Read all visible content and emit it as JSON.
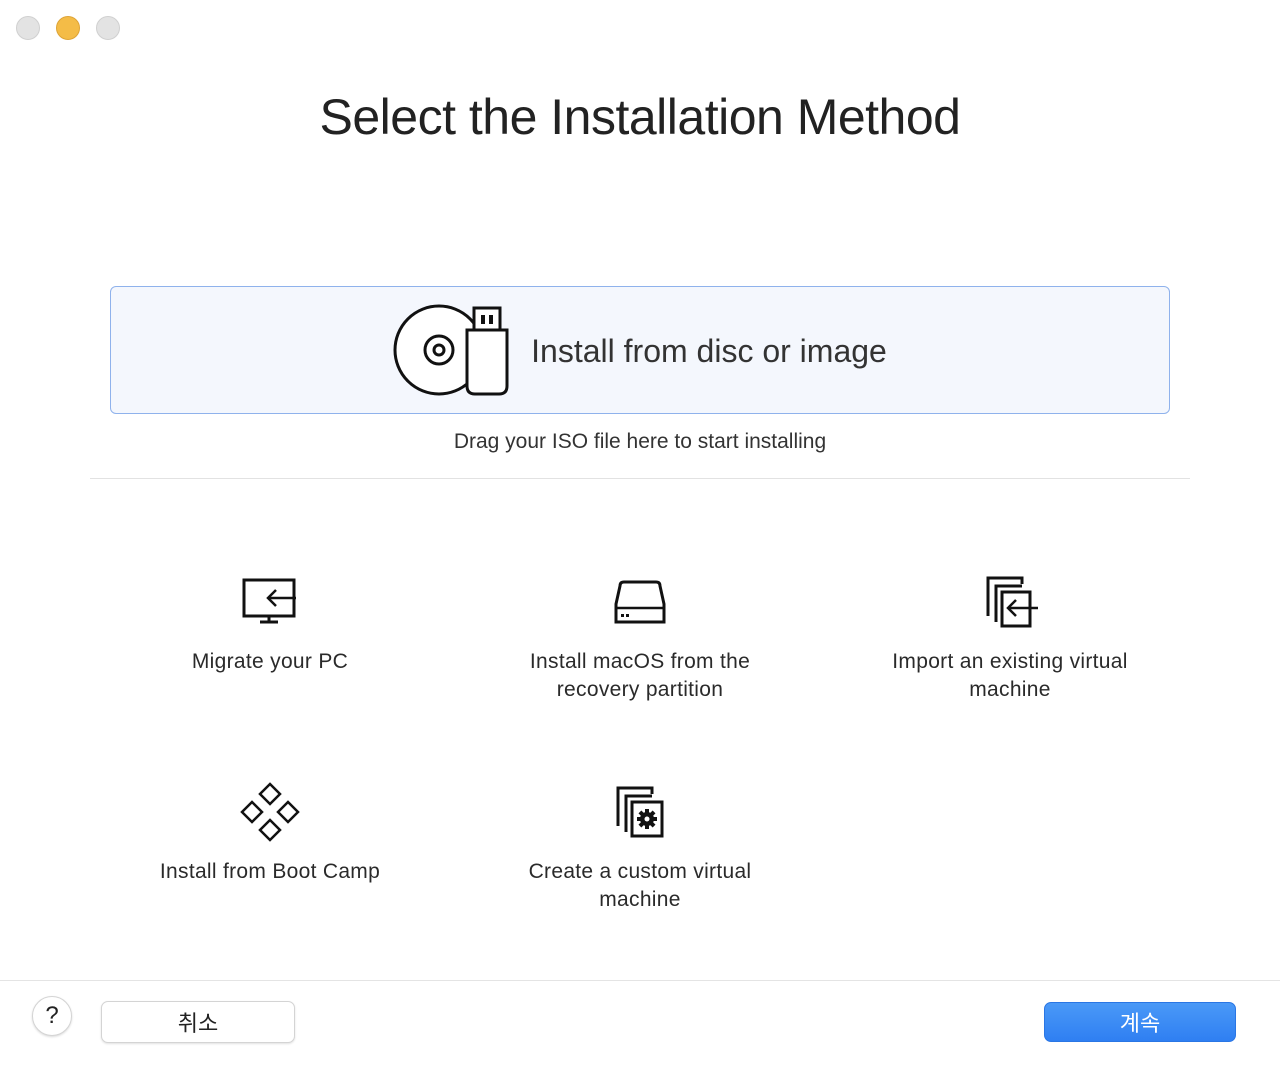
{
  "window": {
    "controls": [
      "close",
      "minimize",
      "zoom"
    ]
  },
  "page": {
    "title": "Select the Installation Method"
  },
  "dropzone": {
    "label": "Install from disc or image",
    "icon": "disc-usb-icon",
    "hint": "Drag your ISO file here to start installing"
  },
  "options": {
    "migrate": {
      "label": "Migrate your PC",
      "icon": "monitor-import-icon"
    },
    "recovery": {
      "label": "Install macOS from the recovery partition",
      "icon": "hard-drive-icon"
    },
    "import": {
      "label": "Import an existing virtual machine",
      "icon": "import-vm-icon"
    },
    "bootcamp": {
      "label": "Install from Boot Camp",
      "icon": "bootcamp-diamonds-icon"
    },
    "custom": {
      "label": "Create a custom virtual machine",
      "icon": "custom-vm-gear-icon"
    }
  },
  "footer": {
    "help_label": "?",
    "cancel_label": "취소",
    "continue_label": "계속"
  },
  "colors": {
    "accent": "#3b8cf5",
    "dropzone_border": "#8fb2ec",
    "dropzone_bg": "#f4f7fd",
    "minimize_light": "#f4bc47"
  }
}
